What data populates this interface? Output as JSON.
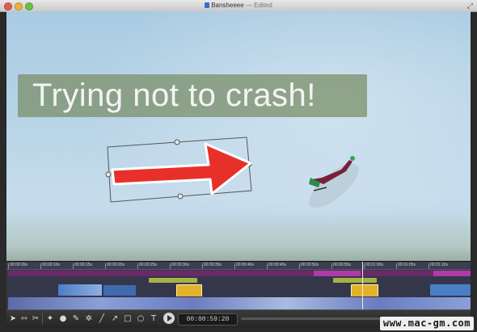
{
  "window": {
    "title": "Bansheeee",
    "title_suffix": "— Edited"
  },
  "canvas": {
    "caption": "Trying not to crash!",
    "caption_bg": "#7a8c64",
    "arrow_color": "#e8302a"
  },
  "timeline": {
    "ruler_labels": [
      "00:00:05s",
      "00:00:10s",
      "00:00:15s",
      "00:00:20s",
      "00:00:25s",
      "00:00:30s",
      "00:00:35s",
      "00:00:40s",
      "00:00:45s",
      "00:00:50s",
      "00:00:55s",
      "00:01:00s",
      "00:01:05s",
      "00:01:10s"
    ],
    "colors": {
      "purple_track": "#b03aa8",
      "annotation": "#a8b048",
      "callout": "#e2b22a",
      "blue_clip": "#4a7ec8",
      "video": "#6b7cc0"
    }
  },
  "toolbar": {
    "timecode": "00:00:59:20",
    "icons": [
      "pointer-icon",
      "trim-icon",
      "cut-icon",
      "transition-icon",
      "mic-icon",
      "pencil-icon",
      "star-icon",
      "line-icon",
      "arrow-icon",
      "rectangle-icon",
      "ellipse-icon",
      "text-icon",
      "play-icon"
    ]
  },
  "watermark": "www.mac-gm.com"
}
